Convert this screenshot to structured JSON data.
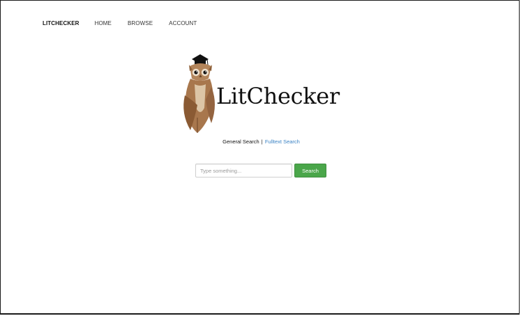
{
  "nav": {
    "brand": "LITCHECKER",
    "links": [
      "HOME",
      "BROWSE",
      "ACCOUNT"
    ]
  },
  "logo": {
    "text": "LitChecker",
    "icon": "owl-with-graduation-cap"
  },
  "search_modes": {
    "general": "General Search",
    "separator": "|",
    "fulltext": "Fulltext Search"
  },
  "search": {
    "placeholder": "Type something...",
    "value": "",
    "button_label": "Search"
  },
  "colors": {
    "button_green": "#4aa64a",
    "link_blue": "#3a82c4",
    "owl_brown": "#a0704a"
  }
}
